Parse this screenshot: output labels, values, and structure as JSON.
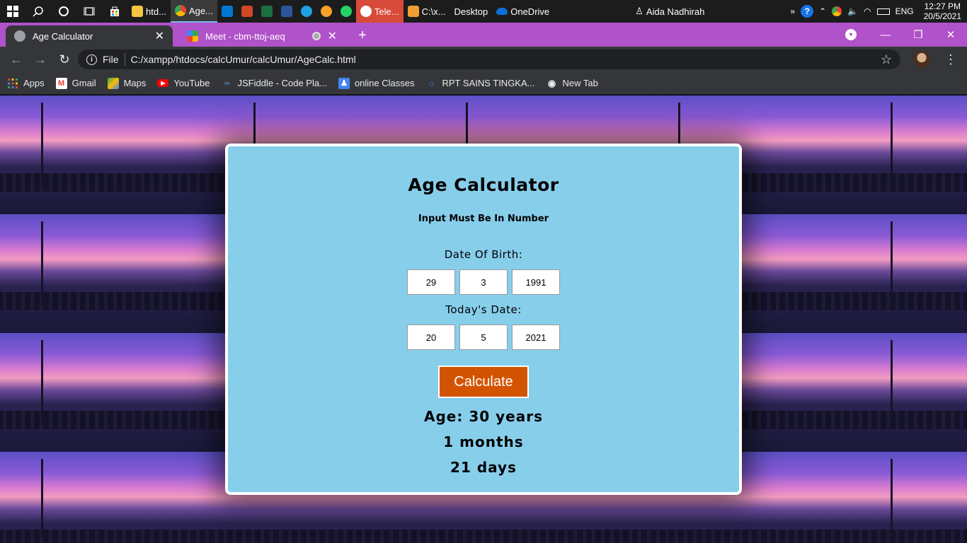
{
  "taskbar": {
    "apps": [
      {
        "label": "htd...",
        "color": "#f5c542",
        "active": false
      },
      {
        "label": "Age...",
        "color": "#4285f4",
        "active": true
      },
      {
        "label": "",
        "color": "#0078d4",
        "active": false
      },
      {
        "label": "",
        "color": "#d24726",
        "active": false
      },
      {
        "label": "",
        "color": "#1d6f42",
        "active": false
      },
      {
        "label": "",
        "color": "#2b579a",
        "active": false
      },
      {
        "label": "",
        "color": "#1fa0e3",
        "active": false
      },
      {
        "label": "",
        "color": "#7b3fe4",
        "active": false
      },
      {
        "label": "",
        "color": "#25d366",
        "active": false
      },
      {
        "label": "Tele...",
        "color": "#e8453c",
        "active": false,
        "red": true
      },
      {
        "label": "C:\\x...",
        "color": "#f0a030",
        "active": false
      }
    ],
    "desktop_label": "Desktop",
    "onedrive_label": "OneDrive",
    "user_label": "Aida Nadhirah",
    "language": "ENG",
    "time": "12:27 PM",
    "date": "20/5/2021"
  },
  "browser": {
    "tabs": [
      {
        "title": "Age Calculator",
        "active": true
      },
      {
        "title": "Meet - cbm-ttoj-aeq",
        "active": false
      }
    ],
    "scheme_label": "File",
    "url": "C:/xampp/htdocs/calcUmur/calcUmur/AgeCalc.html",
    "bookmarks": [
      {
        "label": "Apps",
        "icon": "apps-grid-icon",
        "color": "#e8453c"
      },
      {
        "label": "Gmail",
        "icon": "gmail-icon",
        "color": "#ea4335"
      },
      {
        "label": "Maps",
        "icon": "maps-icon",
        "color": "#34a853"
      },
      {
        "label": "YouTube",
        "icon": "youtube-icon",
        "color": "#ff0000"
      },
      {
        "label": "JSFiddle - Code Pla...",
        "icon": "jsfiddle-icon",
        "color": "#4679bd"
      },
      {
        "label": "online Classes",
        "icon": "classroom-icon",
        "color": "#4285f4"
      },
      {
        "label": "RPT SAINS TINGKA...",
        "icon": "search-icon",
        "color": "#4285f4"
      },
      {
        "label": "New Tab",
        "icon": "globe-icon",
        "color": "#e8eaed"
      }
    ]
  },
  "app": {
    "title": "Age Calculator",
    "note": "Input Must Be In Number",
    "dob_label": "Date Of Birth:",
    "dob": {
      "day": "29",
      "month": "3",
      "year": "1991"
    },
    "today_label": "Today's Date:",
    "today": {
      "day": "20",
      "month": "5",
      "year": "2021"
    },
    "button_label": "Calculate",
    "result_years": "Age: 30 years",
    "result_months": "1 months",
    "result_days": "21 days"
  }
}
